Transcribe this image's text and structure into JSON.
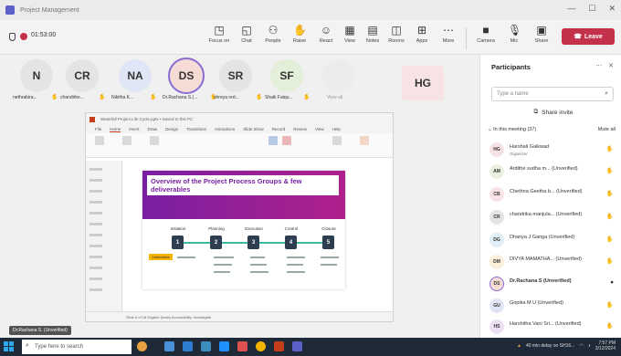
{
  "window": {
    "title": "Project Management"
  },
  "toolbar": {
    "timer": "01:53:00",
    "items": [
      {
        "label": "Focus on",
        "icon": "camera-icon"
      },
      {
        "label": "Chat",
        "icon": "chat-icon"
      },
      {
        "label": "People",
        "icon": "people-icon",
        "count": "37"
      },
      {
        "label": "Raise",
        "icon": "raise-hand-icon"
      },
      {
        "label": "React",
        "icon": "react-icon"
      },
      {
        "label": "View",
        "icon": "view-icon"
      },
      {
        "label": "Notes",
        "icon": "notes-icon"
      },
      {
        "label": "Rooms",
        "icon": "rooms-icon"
      },
      {
        "label": "Apps",
        "icon": "apps-icon"
      },
      {
        "label": "More",
        "icon": "more-icon"
      },
      {
        "label": "Camera",
        "icon": "camera-off-icon"
      },
      {
        "label": "Mic",
        "icon": "mic-icon"
      },
      {
        "label": "Share",
        "icon": "share-icon"
      }
    ],
    "leave_label": "Leave"
  },
  "stage": {
    "participants": [
      {
        "initials": "N",
        "name": "nethrabira...",
        "color": "#e4e4e4"
      },
      {
        "initials": "CR",
        "name": "chandrike...",
        "color": "#e4e4e4"
      },
      {
        "initials": "NA",
        "name": "Nikitha K...",
        "color": "#e0e6f5"
      },
      {
        "initials": "DS",
        "name": "Dr.Rachana S.(...",
        "color": "#f5ddd6"
      },
      {
        "initials": "SR",
        "name": "shreya red...",
        "color": "#e4e4e4"
      },
      {
        "initials": "SF",
        "name": "Shaik Faiqu...",
        "color": "#e3efd9"
      },
      {
        "initials": "",
        "name": "View all",
        "color": "#eaeaea"
      }
    ],
    "floating_participant": {
      "initials": "HG",
      "color": "#f7e3e6"
    },
    "presenter_label": "Dr.Rachana S. (Unverified)"
  },
  "shared_screen": {
    "window_title": "Waterfall Project Life Cycle.pptx • Saved to this PC",
    "menu": [
      "File",
      "Home",
      "Insert",
      "Draw",
      "Design",
      "Transitions",
      "Animations",
      "Slide Show",
      "Record",
      "Review",
      "View",
      "Help"
    ],
    "slide_title": "Overview of the Project Process Groups & few deliverables",
    "phases": [
      "Initiation",
      "Planning",
      "Execution",
      "Control",
      "Closure"
    ],
    "phase_numbers": [
      "1",
      "2",
      "3",
      "4",
      "5"
    ],
    "deliverables_tag": "Deliverables",
    "status": "Slide 6 of 18  English (India)  Accessibility: Investigate"
  },
  "panel": {
    "title": "Participants",
    "search_placeholder": "Type a name",
    "share_invite_label": "Share invite",
    "section_label": "In this meeting (37)",
    "mute_all_label": "Mute all",
    "people": [
      {
        "initials": "HG",
        "name": "Harshali Gaikwad",
        "role": "Organizer",
        "color": "#f7e3e6",
        "icon": "hand-icon"
      },
      {
        "initials": "AM",
        "name": "Ardithe sudha m... (Unverified)",
        "role": "",
        "color": "#eaf3e0",
        "icon": "hand-icon"
      },
      {
        "initials": "CB",
        "name": "Chethna Geetha b... (Unverified)",
        "role": "",
        "color": "#f7e3e6",
        "icon": "hand-icon"
      },
      {
        "initials": "CR",
        "name": "chandrika manjula... (Unverified)",
        "role": "",
        "color": "#e4e4e4",
        "icon": "hand-icon"
      },
      {
        "initials": "DG",
        "name": "Dhanya J Ganga (Unverified)",
        "role": "",
        "color": "#e0eef5",
        "icon": "hand-icon"
      },
      {
        "initials": "DM",
        "name": "DIVYA MAMATHA... (Unverified)",
        "role": "",
        "color": "#fcefd9",
        "icon": "hand-icon"
      },
      {
        "initials": "DS",
        "name": "Dr.Rachana S (Unverified)",
        "role": "",
        "color": "#f5ddd6",
        "icon": "mic-icon"
      },
      {
        "initials": "GU",
        "name": "Gopika M U (Unverified)",
        "role": "",
        "color": "#e0e6f5",
        "icon": "hand-icon"
      },
      {
        "initials": "HS",
        "name": "Harshitha Vani Sri... (Unverified)",
        "role": "",
        "color": "#ece0f5",
        "icon": "hand-icon"
      }
    ]
  },
  "taskbar": {
    "search_placeholder": "Type here to search",
    "tray_text": "40 min delay on SH16...",
    "time": "7:57 PM",
    "date": "3/12/2024"
  }
}
